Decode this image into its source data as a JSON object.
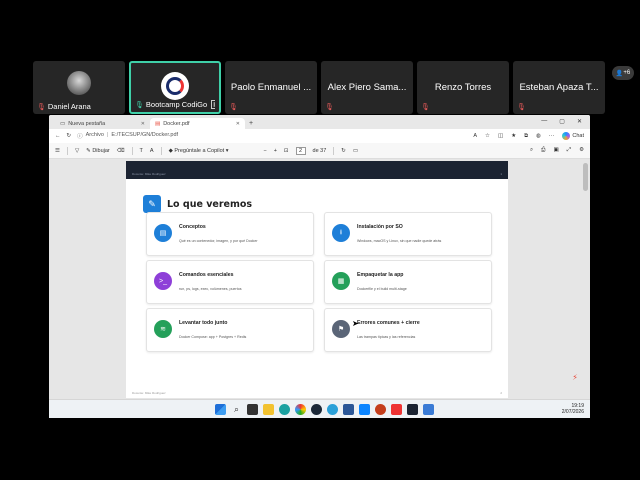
{
  "participants": [
    {
      "name": "Daniel Arana",
      "muted": true,
      "avatar": "photo"
    },
    {
      "name": "Bootcamp CodiGo",
      "muted": false,
      "avatar": "codigo-logo",
      "sharing": true
    },
    {
      "name": "Paolo Enmanuel ..."
    },
    {
      "name": "Alex Piero Sama..."
    },
    {
      "name": "Renzo Torres"
    },
    {
      "name": "Esteban Apaza T..."
    }
  ],
  "more_participants": "+6",
  "browser": {
    "tabs": [
      {
        "label": "Nueva pestaña",
        "active": false
      },
      {
        "label": "Docker.pdf",
        "active": true
      }
    ],
    "address": {
      "prefix": "Archivo",
      "path": "E:/TECSUP/GN/Docker.pdf"
    },
    "chat_label": "Chat",
    "pdf_toolbar": {
      "draw_label": "Dibujar",
      "ask_label": "Pregúntale a Copilot",
      "page_current": "2",
      "page_total": "de 37"
    }
  },
  "document": {
    "header_left": "Docente: Mike Rodriguez",
    "header_right": "1",
    "footer_left": "Docente: Mike Rodriguez",
    "footer_right": "2",
    "title": "Lo que veremos",
    "cards": [
      {
        "title": "Conceptos",
        "desc": "Qué es un contenedor, imagen, y por qué Docker",
        "color": "#1e7fd8",
        "icon": "book-icon"
      },
      {
        "title": "Instalación por SO",
        "desc": "Windows, macOS y Linux, sin que nadie quede atrás",
        "color": "#1e7fd8",
        "icon": "download-icon"
      },
      {
        "title": "Comandos esenciales",
        "desc": "run, ps, logs, exec, volúmenes, puertos",
        "color": "#8e3fd8",
        "icon": "terminal-icon"
      },
      {
        "title": "Empaquetar la app",
        "desc": "Dockerfile y el build multi-stage",
        "color": "#24a05a",
        "icon": "file-icon"
      },
      {
        "title": "Levantar todo junto",
        "desc": "Docker Compose: app + Postgres + Redis",
        "color": "#24a05a",
        "icon": "layers-icon"
      },
      {
        "title": "Errores comunes + cierre",
        "desc": "Las trampas típicas y las referencias",
        "color": "#5a6577",
        "icon": "flag-icon"
      }
    ]
  },
  "clock": {
    "time": "19:19",
    "date": "2/07/2026"
  }
}
